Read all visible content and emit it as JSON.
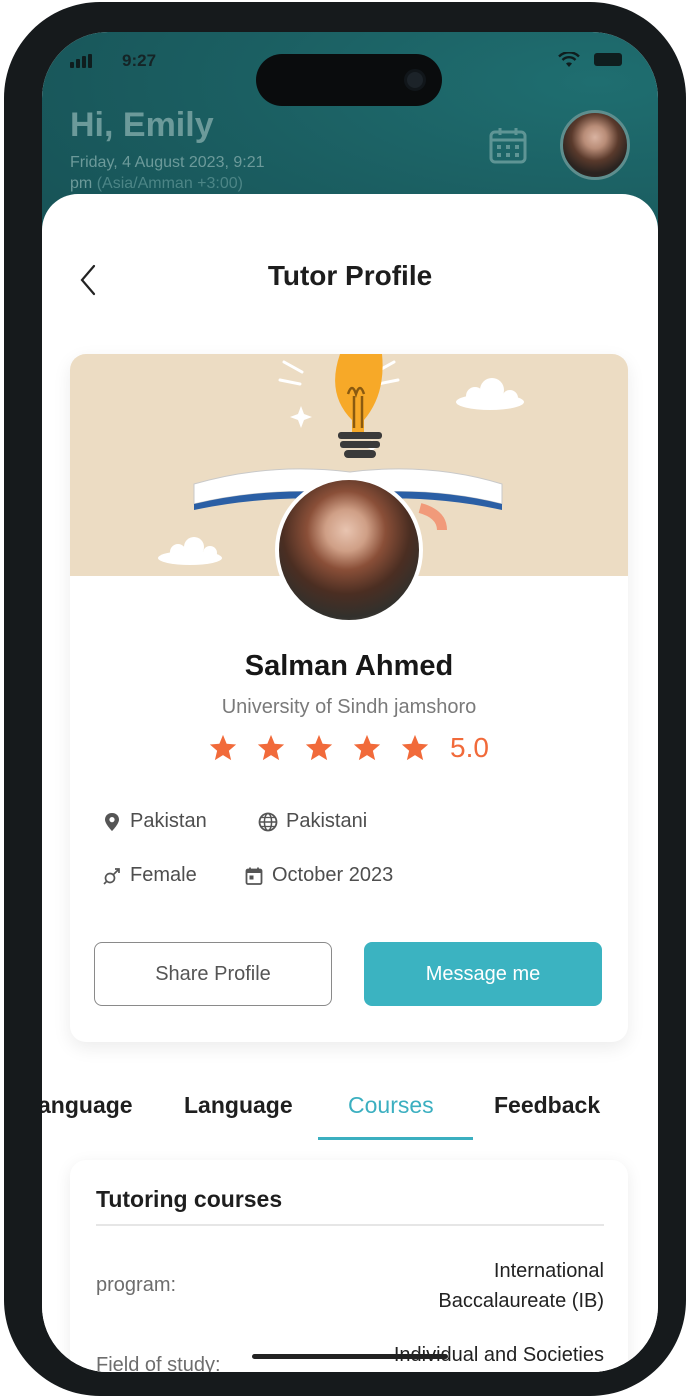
{
  "status": {
    "time": "9:27"
  },
  "header": {
    "greeting": "Hi, Emily",
    "date": "Friday, 4 August 2023, 9:21",
    "date_suffix": "pm",
    "timezone": "(Asia/Amman +3:00)"
  },
  "page": {
    "title": "Tutor Profile"
  },
  "tutor": {
    "name": "Salman Ahmed",
    "university": "University of Sindh jamshoro",
    "stars": 5,
    "rating": "5.0",
    "country": "Pakistan",
    "nationality": "Pakistani",
    "gender": "Female",
    "joined": "October 2023"
  },
  "actions": {
    "share": "Share Profile",
    "message": "Message me"
  },
  "tabs": [
    {
      "label": "anguage"
    },
    {
      "label": "Language"
    },
    {
      "label": "Courses"
    },
    {
      "label": "Feedback"
    }
  ],
  "courses": {
    "title": "Tutoring courses",
    "rows": [
      {
        "label": "program:",
        "value": "International Baccalaureate (IB)"
      },
      {
        "label": "Field of study:",
        "value": "Individual and Societies"
      }
    ]
  },
  "colors": {
    "accent": "#3bb3c1",
    "star": "#f16a3a",
    "header_bg": "#1b5f62"
  },
  "icons": [
    "back-icon",
    "calendar-icon",
    "location-pin-icon",
    "globe-icon",
    "gender-icon",
    "calendar-small-icon",
    "star-icon"
  ]
}
